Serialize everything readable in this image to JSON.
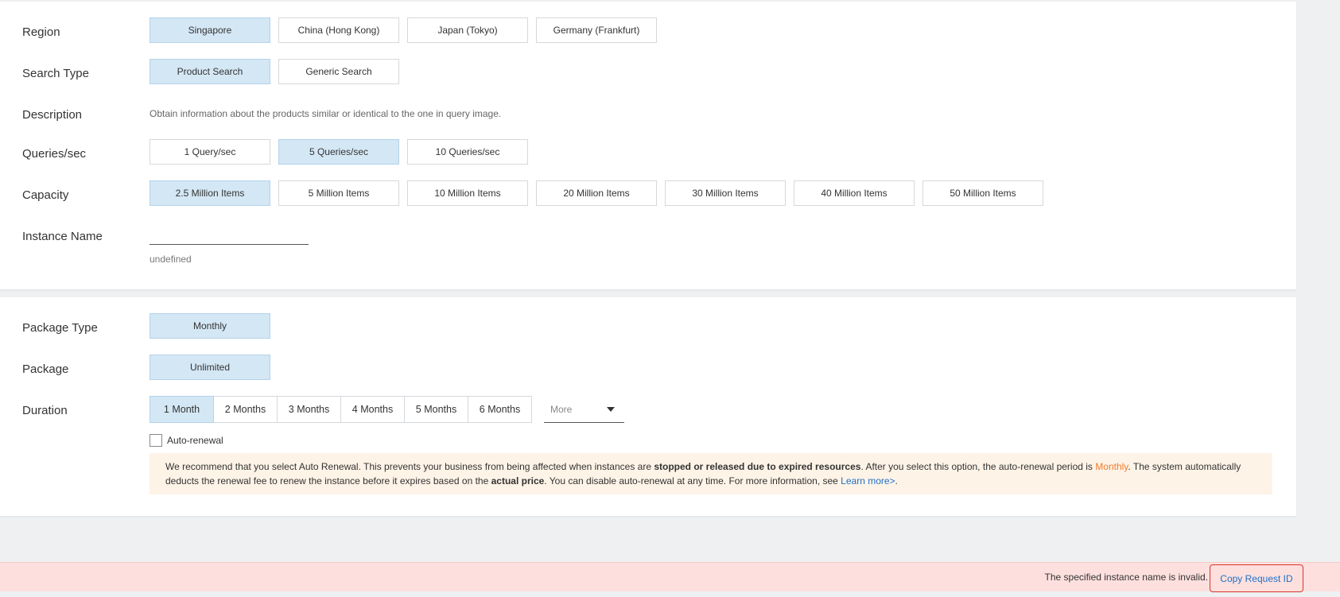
{
  "config": {
    "region": {
      "label": "Region",
      "options": [
        "Singapore",
        "China (Hong Kong)",
        "Japan (Tokyo)",
        "Germany (Frankfurt)"
      ],
      "selected": "Singapore"
    },
    "search_type": {
      "label": "Search Type",
      "options": [
        "Product Search",
        "Generic Search"
      ],
      "selected": "Product Search"
    },
    "description": {
      "label": "Description",
      "text": "Obtain information about the products similar or identical to the one in query image."
    },
    "qps": {
      "label": "Queries/sec",
      "options": [
        "1 Query/sec",
        "5 Queries/sec",
        "10 Queries/sec"
      ],
      "selected": "5 Queries/sec"
    },
    "capacity": {
      "label": "Capacity",
      "options": [
        "2.5 Million Items",
        "5 Million Items",
        "10 Million Items",
        "20 Million Items",
        "30 Million Items",
        "40 Million Items",
        "50 Million Items"
      ],
      "selected": "2.5 Million Items"
    },
    "instance_name": {
      "label": "Instance Name",
      "value": "",
      "hint": "undefined"
    }
  },
  "billing": {
    "package_type": {
      "label": "Package Type",
      "value": "Monthly"
    },
    "package": {
      "label": "Package",
      "value": "Unlimited"
    },
    "duration": {
      "label": "Duration",
      "options": [
        "1 Month",
        "2 Months",
        "3 Months",
        "4 Months",
        "5 Months",
        "6 Months"
      ],
      "selected": "1 Month",
      "more_placeholder": "More"
    },
    "auto_renewal": {
      "label": "Auto-renewal",
      "checked": false
    },
    "notice": {
      "part1": "We recommend that you select Auto Renewal. This prevents your business from being affected when instances are ",
      "bold1": "stopped or released due to expired resources",
      "part2": ". After you select this option, the auto-renewal period is ",
      "period": "Monthly",
      "part3": ". The system automatically deducts the renewal fee to renew the instance before it expires based on the ",
      "bold2": "actual price",
      "part4": ". You can disable auto-renewal at any time. For more information, see ",
      "link": "Learn more>",
      "part5": "."
    }
  },
  "error": {
    "message": "The specified instance name is invalid.",
    "copy_button": "Copy Request ID"
  }
}
